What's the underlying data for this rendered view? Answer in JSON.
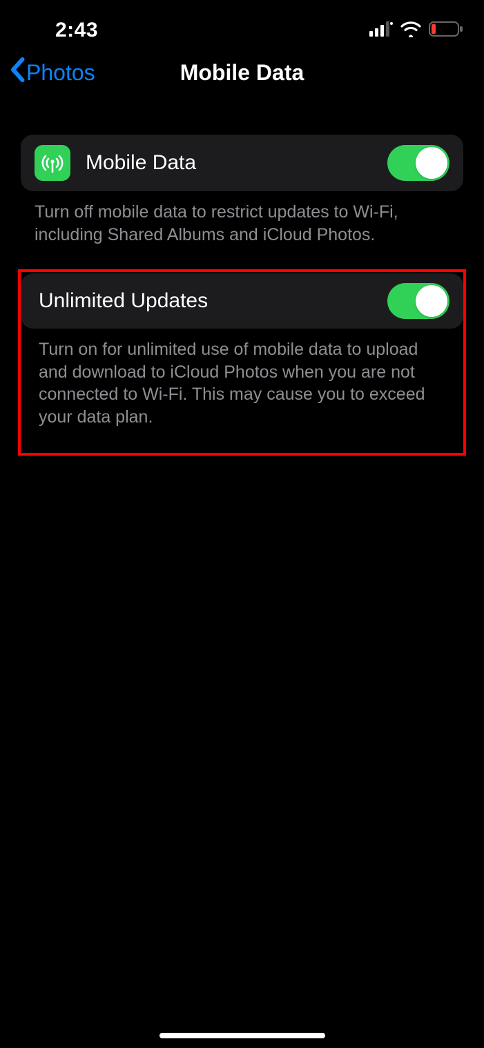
{
  "status": {
    "time": "2:43"
  },
  "nav": {
    "back_label": "Photos",
    "title": "Mobile Data"
  },
  "section1": {
    "label": "Mobile Data",
    "toggle_on": true,
    "footer": "Turn off mobile data to restrict updates to Wi-Fi, including Shared Albums and iCloud Photos."
  },
  "section2": {
    "label": "Unlimited Updates",
    "toggle_on": true,
    "footer": "Turn on for unlimited use of mobile data to upload and download to iCloud Photos when you are not connected to Wi-Fi. This may cause you to exceed your data plan."
  }
}
